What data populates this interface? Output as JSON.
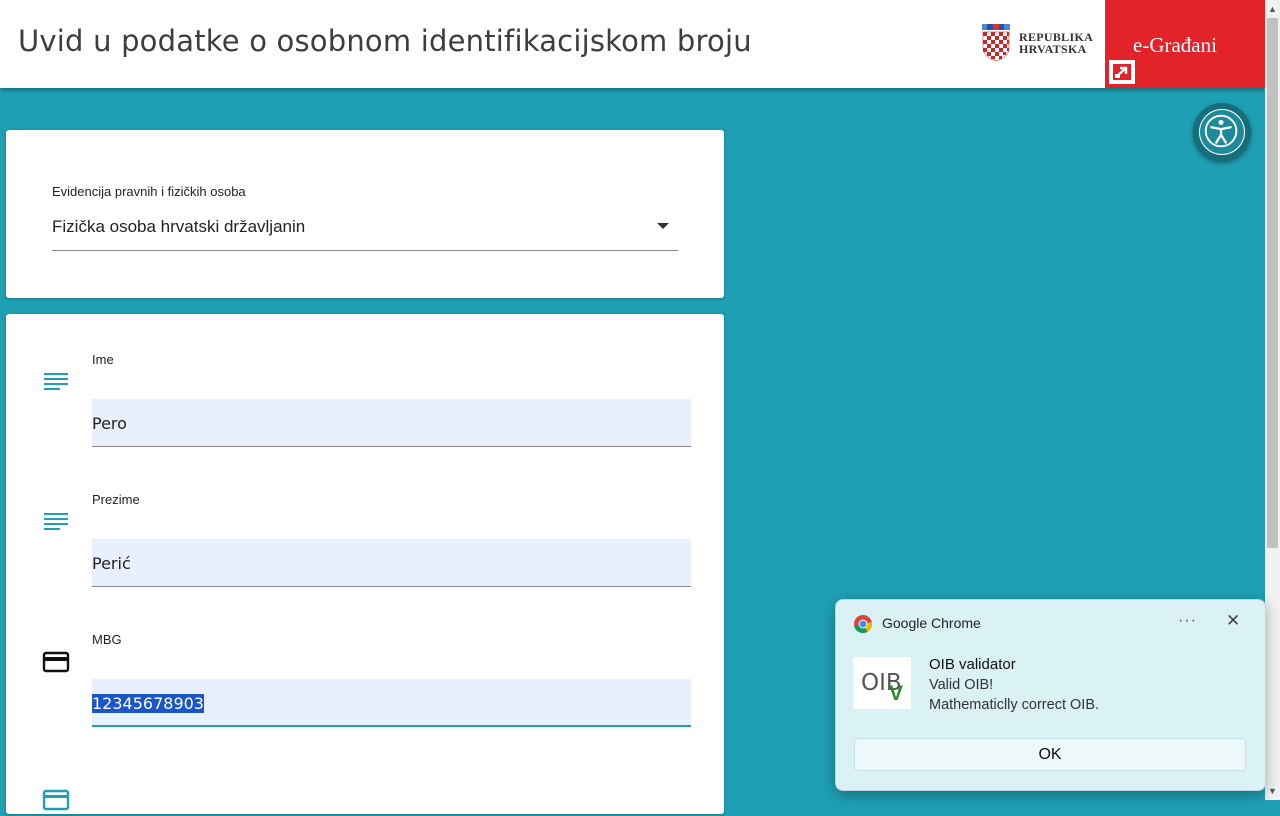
{
  "header": {
    "title": "Uvid u podatke o osobnom identifikacijskom broju",
    "logo_line1": "REPUBLIKA",
    "logo_line2": "HRVATSKA",
    "egradjani": "e-Građani"
  },
  "selector": {
    "label": "Evidencija pravnih i fizičkih osoba",
    "value": "Fizička osoba hrvatski državljanin"
  },
  "fields": [
    {
      "label": "Ime",
      "value": "Pero",
      "icon": "text-lines-icon"
    },
    {
      "label": "Prezime",
      "value": "Perić",
      "icon": "text-lines-icon"
    },
    {
      "label": "MBG",
      "value": "12345678903",
      "icon": "credit-card-icon"
    }
  ],
  "notification": {
    "app": "Google Chrome",
    "title": "OIB validator",
    "line1": "Valid OIB!",
    "line2": "Mathematiclly correct OIB.",
    "button": "OK",
    "logo_text": "OIB",
    "logo_mark": "V"
  },
  "colors": {
    "background": "#1f9fb3",
    "egradjani_red": "#e2232a",
    "input_bg": "#e8f0fe",
    "toast_bg": "#daf1f5"
  }
}
